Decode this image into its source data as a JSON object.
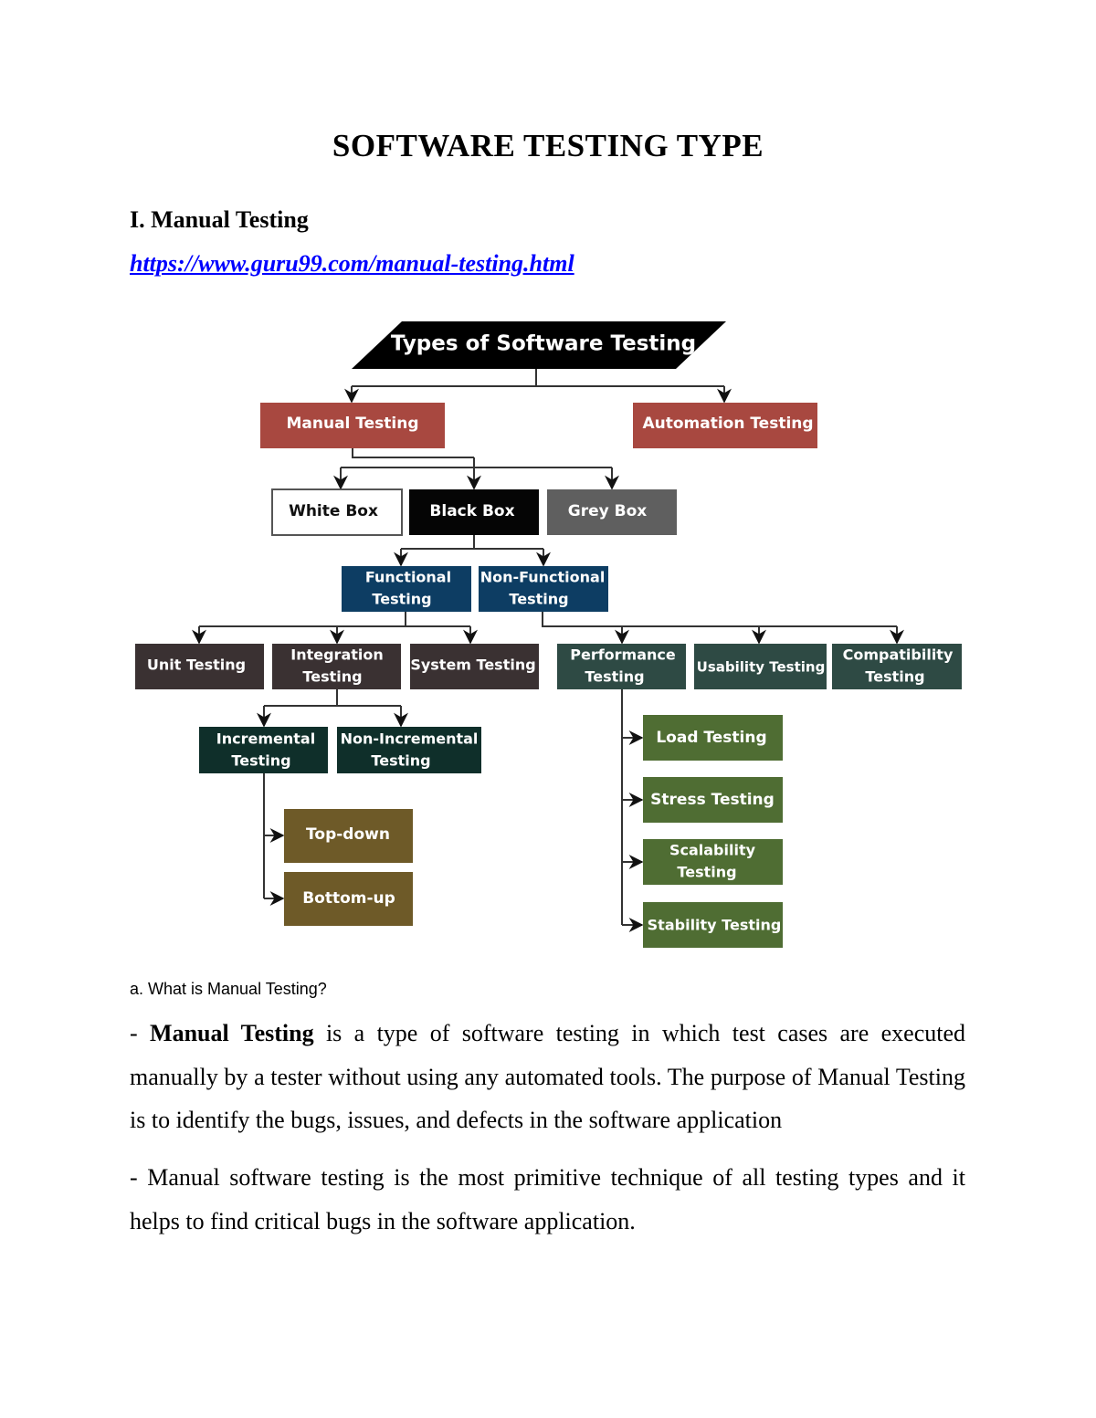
{
  "document": {
    "title": "SOFTWARE TESTING TYPE",
    "section_heading": "I. Manual Testing",
    "link": "https://www.guru99.com/manual-testing.html",
    "subheading": "a. What is Manual Testing?",
    "paragraph1": {
      "prefix": "- ",
      "bold": "Manual Testing",
      "rest": " is a type of software testing in which test cases are executed manually by a tester without using any automated tools. The purpose of Manual Testing is to identify the bugs, issues, and defects in the software application"
    },
    "paragraph2": "- Manual software testing is the most primitive technique of all testing types and it helps to find critical bugs in the software application."
  },
  "diagram": {
    "title": "Types of Software Testing",
    "nodes": {
      "manual": "Manual Testing",
      "automation": "Automation Testing",
      "white_box": "White Box",
      "black_box": "Black Box",
      "grey_box": "Grey Box",
      "functional": [
        "Functional",
        "Testing"
      ],
      "non_functional": [
        "Non-Functional",
        "Testing"
      ],
      "unit": "Unit Testing",
      "integration": [
        "Integration",
        "Testing"
      ],
      "system": "System Testing",
      "performance": [
        "Performance",
        "Testing"
      ],
      "usability": "Usability Testing",
      "compatibility": [
        "Compatibility",
        "Testing"
      ],
      "incremental": [
        "Incremental",
        "Testing"
      ],
      "non_incremental": [
        "Non-Incremental",
        "Testing"
      ],
      "top_down": "Top-down",
      "bottom_up": "Bottom-up",
      "load": "Load Testing",
      "stress": "Stress Testing",
      "scalability": [
        "Scalability",
        "Testing"
      ],
      "stability": "Stability Testing"
    },
    "colors": {
      "title_bg": "#000000",
      "level1": "#a84840",
      "white_box": "#ffffff",
      "black_box": "#050505",
      "grey_box": "#5f5f5f",
      "functional": "#0d3d63",
      "functional_children": "#3a3132",
      "non_functional_children": "#2e4a44",
      "incremental_level": "#0f2f2a",
      "integration_approaches": "#6e5a28",
      "performance_children": "#4f6d33"
    }
  }
}
